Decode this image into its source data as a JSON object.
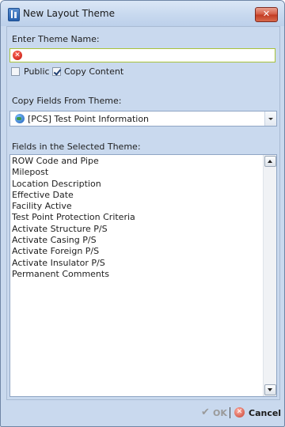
{
  "window": {
    "title": "New Layout Theme",
    "close_glyph": "✕"
  },
  "form": {
    "theme_name_label": "Enter Theme Name:",
    "theme_name_value": "",
    "error_glyph": "✕",
    "public": {
      "label": "Public",
      "checked": false
    },
    "copy_content": {
      "label": "Copy Content",
      "checked": true
    },
    "copy_fields_label": "Copy Fields From Theme:",
    "copy_fields_selected": "[PCS] Test Point Information",
    "fields_label": "Fields in the Selected Theme:",
    "fields": [
      "ROW Code and Pipe",
      "Milepost",
      "Location Description",
      "Effective Date",
      "Facility Active",
      "Test Point Protection Criteria",
      "Activate Structure P/S",
      "Activate Casing P/S",
      "Activate Foreign P/S",
      "Activate Insulator P/S",
      "Permanent Comments"
    ]
  },
  "footer": {
    "ok_label": "OK",
    "ok_glyph": "✔",
    "cancel_label": "Cancel",
    "cancel_glyph": "✕"
  },
  "icons": [
    "app-icon",
    "close-icon",
    "error-icon",
    "globe-icon",
    "checkmark-icon",
    "cancel-icon",
    "scroll-up-icon",
    "scroll-down-icon"
  ]
}
